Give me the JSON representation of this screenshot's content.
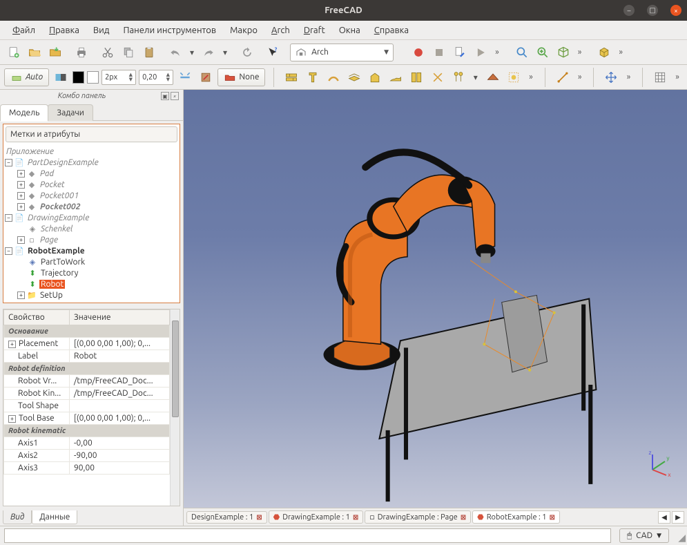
{
  "window": {
    "title": "FreeCAD"
  },
  "menu": {
    "file": "айл",
    "file_u": "Ф",
    "edit": "равка",
    "edit_u": "П",
    "view": "Ви",
    "view_suffix": "д",
    "view_u": "д",
    "panels": "Панели инструментов",
    "macro": "Макро",
    "arch": "rch",
    "arch_u": "A",
    "draft": "raft",
    "draft_u": "D",
    "windows": "Окна",
    "help": "правка",
    "help_u": "С"
  },
  "toolbar1": {
    "workbench_label": "Arch"
  },
  "toolbar2": {
    "auto": "Auto",
    "px": "2px",
    "scale": "0,20",
    "none": "None"
  },
  "combo_panel": {
    "title": "Комбо панель",
    "tab_model": "Модель",
    "tab_tasks": "Задачи",
    "attr_header": "Метки и атрибуты",
    "root": "Приложение",
    "items": {
      "pde": "PartDesignExample",
      "pad": "Pad",
      "pocket": "Pocket",
      "pocket001": "Pocket001",
      "pocket002": "Pocket002",
      "de": "DrawingExample",
      "schenkel": "Schenkel",
      "page": "Page",
      "re": "RobotExample",
      "parttowork": "PartToWork",
      "trajectory": "Trajectory",
      "robot": "Robot",
      "setup": "SetUp"
    }
  },
  "props": {
    "col_prop": "Свойство",
    "col_val": "Значение",
    "group_base": "Основание",
    "placement": "Placement",
    "placement_v": "[(0,00 0,00 1,00); 0,...",
    "label": "Label",
    "label_v": "Robot",
    "group_robotdef": "Robot definition",
    "robotvr": "Robot Vr...",
    "robotvr_v": "/tmp/FreeCAD_Doc...",
    "robotkin": "Robot Kin...",
    "robotkin_v": "/tmp/FreeCAD_Doc...",
    "toolshape": "Tool Shape",
    "toolshape_v": "",
    "toolbase": "Tool Base",
    "toolbase_v": "[(0,00 0,00 1,00); 0,...",
    "group_robotkinematic": "Robot kinematic",
    "axis1": "Axis1",
    "axis1_v": "-0,00",
    "axis2": "Axis2",
    "axis2_v": "-90,00",
    "axis3": "Axis3",
    "axis3_v": "90,00"
  },
  "bottom_tabs": {
    "view": "Вид",
    "data": "Данные"
  },
  "doc_tabs": {
    "t1": "DesignExample : 1",
    "t2": "DrawingExample : 1",
    "t3": "DrawingExample : Page",
    "t4": "RobotExample : 1"
  },
  "status": {
    "cad": "CAD"
  },
  "axis": {
    "x": "x",
    "y": "y",
    "z": "z"
  }
}
